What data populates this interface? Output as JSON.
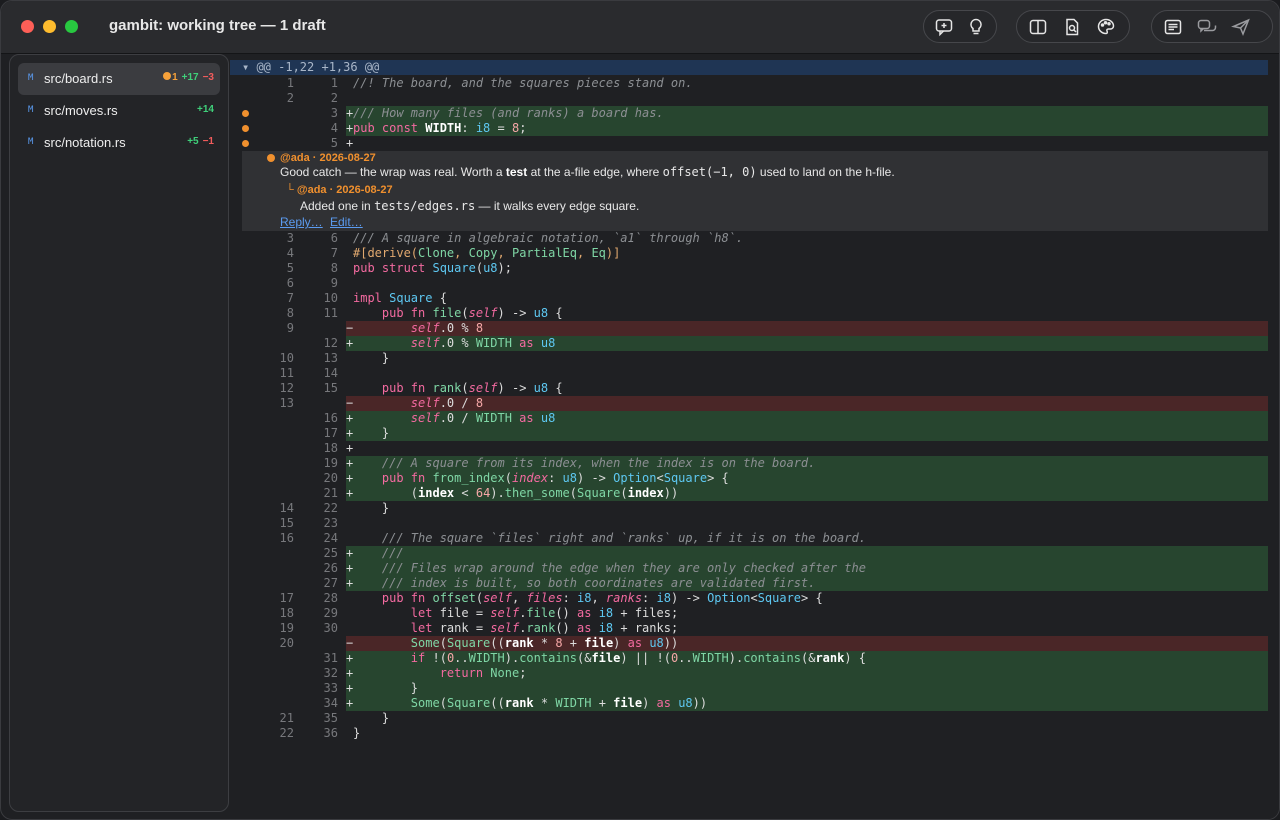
{
  "window": {
    "title": "gambit: working tree — 1 draft"
  },
  "toolbar": {
    "groups": [
      [
        "add-comment-icon",
        "lightbulb-icon"
      ],
      [
        "split-view-icon",
        "search-document-icon",
        "palette-icon"
      ],
      [
        "review-list-icon",
        "chat-icon",
        "send-icon"
      ]
    ]
  },
  "files": [
    {
      "status": "M",
      "name": "src/board.rs",
      "drafts": "1",
      "added": "+17",
      "removed": "−3"
    },
    {
      "status": "M",
      "name": "src/moves.rs",
      "added": "+14"
    },
    {
      "status": "M",
      "name": "src/notation.rs",
      "added": "+5",
      "removed": "−1"
    }
  ],
  "diff": {
    "hunk": "▾ @@ -1,22 +1,36 @@",
    "thread": {
      "comment": {
        "author": "@ada · 2026-08-27",
        "parts": [
          {
            "text": "Good catch — the wrap was real. Worth a "
          },
          {
            "text": "test",
            "bold": true
          },
          {
            "text": " at the a-file edge, where "
          },
          {
            "text": "offset(−1, 0)",
            "mono": true
          },
          {
            "text": " used to land on the h-file."
          }
        ]
      },
      "reply": {
        "author": "└ @ada · 2026-08-27",
        "parts": [
          {
            "text": "Added one in "
          },
          {
            "text": "tests/edges.rs",
            "mono": true
          },
          {
            "text": " — it walks every edge square."
          }
        ]
      },
      "links": [
        "Reply…",
        "Edit…"
      ]
    },
    "lines": [
      {
        "o": "1",
        "n": "1",
        "t": "ctx",
        "code": [
          [
            "c",
            "//! The board, and the squares pieces stand on."
          ]
        ]
      },
      {
        "o": "2",
        "n": "2",
        "t": "ctx",
        "code": []
      },
      {
        "n": "3",
        "t": "add",
        "draft": true,
        "code": [
          [
            "c",
            "/// How many files (and ranks) a board has."
          ]
        ]
      },
      {
        "n": "4",
        "t": "add",
        "draft": true,
        "code": [
          [
            "k",
            "pub const "
          ],
          [
            "v",
            "WIDTH"
          ],
          [
            "a",
            ": "
          ],
          [
            "t",
            "i8"
          ],
          [
            "a",
            " = "
          ],
          [
            "n",
            "8"
          ],
          [
            "a",
            ";"
          ]
        ]
      },
      {
        "n": "5",
        "t": "add",
        "draft": true,
        "code": []
      },
      {
        "thread": true
      },
      {
        "o": "3",
        "n": "6",
        "t": "ctx",
        "code": [
          [
            "c",
            "/// A square in algebraic notation, `a1` through `h8`."
          ]
        ]
      },
      {
        "o": "4",
        "n": "7",
        "t": "ctx",
        "code": [
          [
            "d",
            "#[derive("
          ],
          [
            "g",
            "Clone"
          ],
          [
            "d",
            ", "
          ],
          [
            "g",
            "Copy"
          ],
          [
            "d",
            ", "
          ],
          [
            "g",
            "PartialEq"
          ],
          [
            "d",
            ", "
          ],
          [
            "g",
            "Eq"
          ],
          [
            "d",
            ")]"
          ]
        ]
      },
      {
        "o": "5",
        "n": "8",
        "t": "ctx",
        "code": [
          [
            "k",
            "pub struct "
          ],
          [
            "t",
            "Square"
          ],
          [
            "a",
            "("
          ],
          [
            "t",
            "u8"
          ],
          [
            "a",
            ");"
          ]
        ]
      },
      {
        "o": "6",
        "n": "9",
        "t": "ctx",
        "code": []
      },
      {
        "o": "7",
        "n": "10",
        "t": "ctx",
        "code": [
          [
            "k",
            "impl "
          ],
          [
            "t",
            "Square"
          ],
          [
            "a",
            " {"
          ]
        ]
      },
      {
        "o": "8",
        "n": "11",
        "t": "ctx",
        "code": [
          [
            "a",
            "    "
          ],
          [
            "k",
            "pub fn "
          ],
          [
            "g",
            "file"
          ],
          [
            "a",
            "("
          ],
          [
            "s",
            "self"
          ],
          [
            "a",
            ") -> "
          ],
          [
            "t",
            "u8"
          ],
          [
            "a",
            " {"
          ]
        ]
      },
      {
        "o": "9",
        "t": "del",
        "code": [
          [
            "a",
            "        "
          ],
          [
            "s",
            "self"
          ],
          [
            "a",
            ".0 % "
          ],
          [
            "n",
            "8"
          ]
        ]
      },
      {
        "n": "12",
        "t": "add",
        "code": [
          [
            "a",
            "        "
          ],
          [
            "s",
            "self"
          ],
          [
            "a",
            ".0 % "
          ],
          [
            "g",
            "WIDTH"
          ],
          [
            "k",
            " as "
          ],
          [
            "t",
            "u8"
          ]
        ]
      },
      {
        "o": "10",
        "n": "13",
        "t": "ctx",
        "code": [
          [
            "a",
            "    }"
          ]
        ]
      },
      {
        "o": "11",
        "n": "14",
        "t": "ctx",
        "code": []
      },
      {
        "o": "12",
        "n": "15",
        "t": "ctx",
        "code": [
          [
            "a",
            "    "
          ],
          [
            "k",
            "pub fn "
          ],
          [
            "g",
            "rank"
          ],
          [
            "a",
            "("
          ],
          [
            "s",
            "self"
          ],
          [
            "a",
            ") -> "
          ],
          [
            "t",
            "u8"
          ],
          [
            "a",
            " {"
          ]
        ]
      },
      {
        "o": "13",
        "t": "del",
        "code": [
          [
            "a",
            "        "
          ],
          [
            "s",
            "self"
          ],
          [
            "a",
            ".0 / "
          ],
          [
            "n",
            "8"
          ]
        ]
      },
      {
        "n": "16",
        "t": "add",
        "code": [
          [
            "a",
            "        "
          ],
          [
            "s",
            "self"
          ],
          [
            "a",
            ".0 / "
          ],
          [
            "g",
            "WIDTH"
          ],
          [
            "k",
            " as "
          ],
          [
            "t",
            "u8"
          ]
        ]
      },
      {
        "n": "17",
        "t": "add",
        "code": [
          [
            "a",
            "    }"
          ]
        ]
      },
      {
        "n": "18",
        "t": "add",
        "code": []
      },
      {
        "n": "19",
        "t": "add",
        "code": [
          [
            "a",
            "    "
          ],
          [
            "c",
            "/// A square from its index, when the index is on the board."
          ]
        ]
      },
      {
        "n": "20",
        "t": "add",
        "code": [
          [
            "a",
            "    "
          ],
          [
            "k",
            "pub fn "
          ],
          [
            "g",
            "from_index"
          ],
          [
            "a",
            "("
          ],
          [
            "s",
            "index"
          ],
          [
            "a",
            ": "
          ],
          [
            "t",
            "u8"
          ],
          [
            "a",
            ") -> "
          ],
          [
            "t",
            "Option"
          ],
          [
            "a",
            "<"
          ],
          [
            "t",
            "Square"
          ],
          [
            "a",
            "> {"
          ]
        ]
      },
      {
        "n": "21",
        "t": "add",
        "code": [
          [
            "a",
            "        ("
          ],
          [
            "v",
            "index"
          ],
          [
            "a",
            " < "
          ],
          [
            "n",
            "64"
          ],
          [
            "a",
            ")."
          ],
          [
            "g",
            "then_some"
          ],
          [
            "a",
            "("
          ],
          [
            "g",
            "Square"
          ],
          [
            "a",
            "("
          ],
          [
            "v",
            "index"
          ],
          [
            "a",
            "))"
          ]
        ]
      },
      {
        "o": "14",
        "n": "22",
        "t": "ctx",
        "code": [
          [
            "a",
            "    }"
          ]
        ]
      },
      {
        "o": "15",
        "n": "23",
        "t": "ctx",
        "code": []
      },
      {
        "o": "16",
        "n": "24",
        "t": "ctx",
        "code": [
          [
            "a",
            "    "
          ],
          [
            "c",
            "/// The square `files` right and `ranks` up, if it is on the board."
          ]
        ]
      },
      {
        "n": "25",
        "t": "add",
        "code": [
          [
            "a",
            "    "
          ],
          [
            "c",
            "///"
          ]
        ]
      },
      {
        "n": "26",
        "t": "add",
        "code": [
          [
            "a",
            "    "
          ],
          [
            "c",
            "/// Files wrap around the edge when they are only checked after the"
          ]
        ]
      },
      {
        "n": "27",
        "t": "add",
        "code": [
          [
            "a",
            "    "
          ],
          [
            "c",
            "/// index is built, so both coordinates are validated first."
          ]
        ]
      },
      {
        "o": "17",
        "n": "28",
        "t": "ctx",
        "code": [
          [
            "a",
            "    "
          ],
          [
            "k",
            "pub fn "
          ],
          [
            "g",
            "offset"
          ],
          [
            "a",
            "("
          ],
          [
            "s",
            "self"
          ],
          [
            "a",
            ", "
          ],
          [
            "s",
            "files"
          ],
          [
            "a",
            ": "
          ],
          [
            "t",
            "i8"
          ],
          [
            "a",
            ", "
          ],
          [
            "s",
            "ranks"
          ],
          [
            "a",
            ": "
          ],
          [
            "t",
            "i8"
          ],
          [
            "a",
            ") -> "
          ],
          [
            "t",
            "Option"
          ],
          [
            "a",
            "<"
          ],
          [
            "t",
            "Square"
          ],
          [
            "a",
            "> {"
          ]
        ]
      },
      {
        "o": "18",
        "n": "29",
        "t": "ctx",
        "code": [
          [
            "a",
            "        "
          ],
          [
            "k",
            "let "
          ],
          [
            "a",
            "file = "
          ],
          [
            "s",
            "self"
          ],
          [
            "a",
            "."
          ],
          [
            "g",
            "file"
          ],
          [
            "a",
            "() "
          ],
          [
            "k",
            "as "
          ],
          [
            "t",
            "i8"
          ],
          [
            "a",
            " + files;"
          ]
        ]
      },
      {
        "o": "19",
        "n": "30",
        "t": "ctx",
        "code": [
          [
            "a",
            "        "
          ],
          [
            "k",
            "let "
          ],
          [
            "a",
            "rank = "
          ],
          [
            "s",
            "self"
          ],
          [
            "a",
            "."
          ],
          [
            "g",
            "rank"
          ],
          [
            "a",
            "() "
          ],
          [
            "k",
            "as "
          ],
          [
            "t",
            "i8"
          ],
          [
            "a",
            " + ranks;"
          ]
        ]
      },
      {
        "o": "20",
        "t": "del",
        "code": [
          [
            "a",
            "        "
          ],
          [
            "g",
            "Some"
          ],
          [
            "a",
            "("
          ],
          [
            "g",
            "Square"
          ],
          [
            "a",
            "(("
          ],
          [
            "v",
            "rank"
          ],
          [
            "a",
            " * "
          ],
          [
            "n",
            "8"
          ],
          [
            "a",
            " + "
          ],
          [
            "v",
            "file"
          ],
          [
            "a",
            ") "
          ],
          [
            "k",
            "as "
          ],
          [
            "t",
            "u8"
          ],
          [
            "a",
            "))"
          ]
        ]
      },
      {
        "n": "31",
        "t": "add",
        "code": [
          [
            "a",
            "        "
          ],
          [
            "k",
            "if "
          ],
          [
            "a",
            "!("
          ],
          [
            "n",
            "0"
          ],
          [
            "a",
            ".."
          ],
          [
            "g",
            "WIDTH"
          ],
          [
            "a",
            ")."
          ],
          [
            "g",
            "contains"
          ],
          [
            "a",
            "(&"
          ],
          [
            "v",
            "file"
          ],
          [
            "a",
            ") || !("
          ],
          [
            "n",
            "0"
          ],
          [
            "a",
            ".."
          ],
          [
            "g",
            "WIDTH"
          ],
          [
            "a",
            ")."
          ],
          [
            "g",
            "contains"
          ],
          [
            "a",
            "(&"
          ],
          [
            "v",
            "rank"
          ],
          [
            "a",
            ") {"
          ]
        ]
      },
      {
        "n": "32",
        "t": "add",
        "code": [
          [
            "a",
            "            "
          ],
          [
            "k",
            "return "
          ],
          [
            "g",
            "None"
          ],
          [
            "a",
            ";"
          ]
        ]
      },
      {
        "n": "33",
        "t": "add",
        "code": [
          [
            "a",
            "        }"
          ]
        ]
      },
      {
        "n": "34",
        "t": "add",
        "code": [
          [
            "a",
            "        "
          ],
          [
            "g",
            "Some"
          ],
          [
            "a",
            "("
          ],
          [
            "g",
            "Square"
          ],
          [
            "a",
            "(("
          ],
          [
            "v",
            "rank"
          ],
          [
            "a",
            " * "
          ],
          [
            "g",
            "WIDTH"
          ],
          [
            "a",
            " + "
          ],
          [
            "v",
            "file"
          ],
          [
            "a",
            ") "
          ],
          [
            "k",
            "as "
          ],
          [
            "t",
            "u8"
          ],
          [
            "a",
            "))"
          ]
        ]
      },
      {
        "o": "21",
        "n": "35",
        "t": "ctx",
        "code": [
          [
            "a",
            "    }"
          ]
        ]
      },
      {
        "o": "22",
        "n": "36",
        "t": "ctx",
        "code": [
          [
            "a",
            "}"
          ]
        ]
      }
    ]
  }
}
